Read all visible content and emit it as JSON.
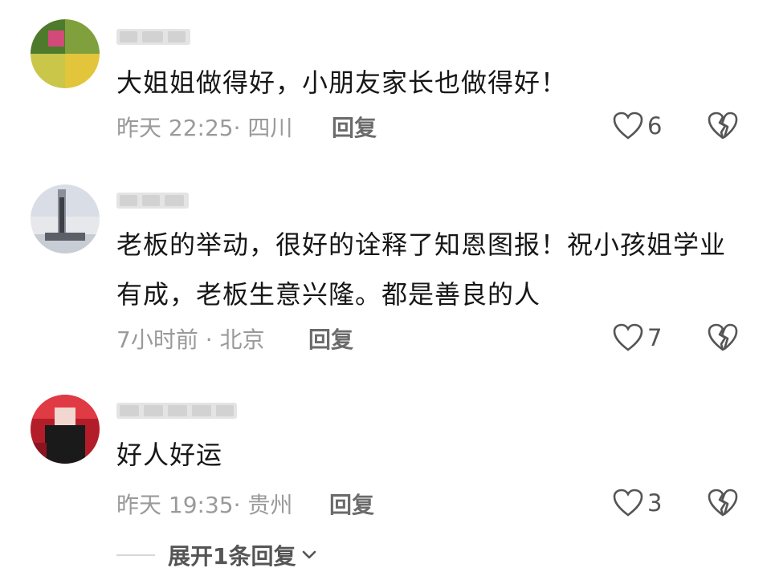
{
  "comments": [
    {
      "text": "大姐姐做得好，小朋友家长也做得好！",
      "meta": "昨天 22:25· 四川",
      "reply_label": "回复",
      "likes": "6",
      "avatar_colors": [
        "#4e7a2c",
        "#7fa03c",
        "#c9c64a",
        "#d24a7a",
        "#3e6a28",
        "#e2c53a"
      ]
    },
    {
      "text": "老板的举动，很好的诠释了知恩图报！祝小孩姐学业有成，老板生意兴隆。都是善良的人",
      "meta": "7小时前 · 北京",
      "reply_label": "回复",
      "likes": "7",
      "avatar_colors": [
        "#d9dde6",
        "#8a8f9a",
        "#3c3f46",
        "#c8ccd4",
        "#5b5f68",
        "#e6e8ec"
      ]
    },
    {
      "text": "好人好运",
      "meta": "昨天 19:35· 贵州",
      "reply_label": "回复",
      "likes": "3",
      "avatar_colors": [
        "#b31d2a",
        "#e03a44",
        "#1a1a1a",
        "#f2d6d0",
        "#8b1420",
        "#2a2a2a"
      ]
    }
  ],
  "expand_label": "展开1条回复",
  "icons": {
    "like": "heart-outline-icon",
    "dislike": "broken-heart-icon",
    "expand": "chevron-down-icon"
  }
}
